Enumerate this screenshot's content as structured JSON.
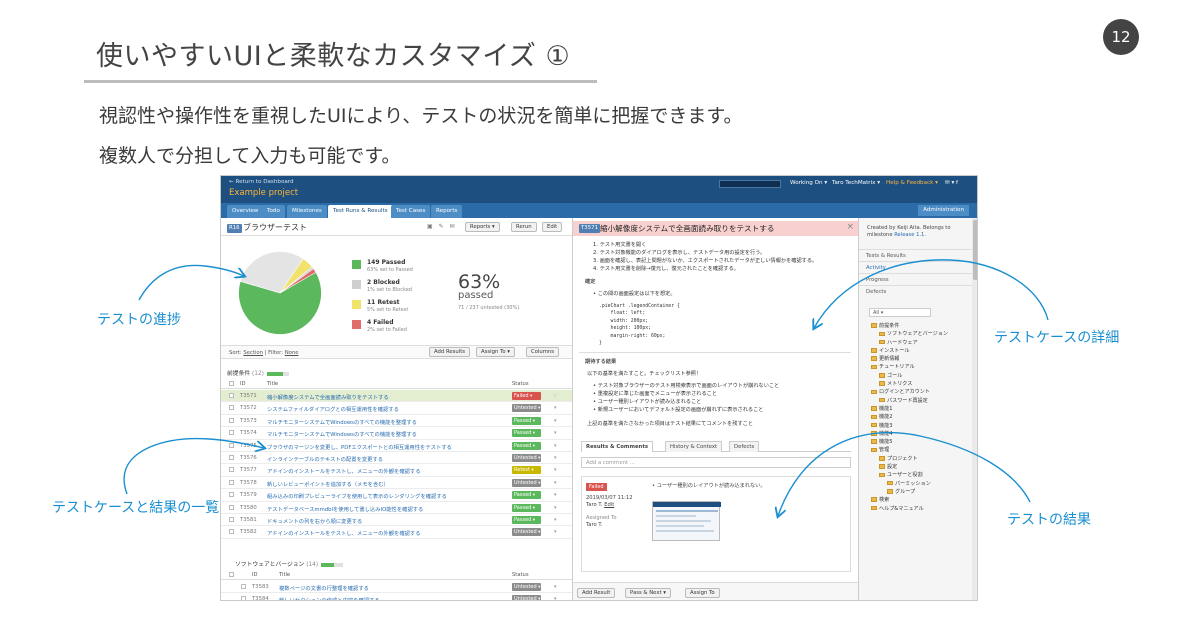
{
  "slide": {
    "title": "使いやすいUIと柔軟なカスタマイズ ①",
    "page_number": "12",
    "subtitle1": "視認性や操作性を重視したUIにより、テストの状況を簡単に把握できます。",
    "subtitle2": "複数人で分担して入力も可能です。",
    "callouts": {
      "progress": "テストの進捗",
      "case_list": "テストケースと結果の一覧",
      "case_detail": "テストケースの詳細",
      "result": "テストの結果"
    },
    "accent_color": "#1a8fd0"
  },
  "app": {
    "back_link": "← Return to Dashboard",
    "project": "Example project",
    "top_nav": {
      "working_on": "Working On ▾",
      "user": "Taro TechMatrix ▾",
      "help": "Help & Feedback ▾",
      "icons": "✉ ▾ f"
    },
    "tabs": [
      "Overview",
      "Todo",
      "Milestones",
      "Test Runs & Results",
      "Test Cases",
      "Reports"
    ],
    "active_tab": "Test Runs & Results",
    "admin_tab": "Administration",
    "run": {
      "badge": "R16",
      "title": "ブラウザーテスト",
      "buttons": {
        "reports": "Reports ▾",
        "rerun": "Rerun",
        "edit": "Edit"
      },
      "stats": [
        {
          "label": "149 Passed",
          "sub": "63% set to Passed",
          "color": "#5cb85c",
          "value": 149
        },
        {
          "label": "2 Blocked",
          "sub": "1% set to Blocked",
          "color": "#cfcfcf",
          "value": 2
        },
        {
          "label": "11 Retest",
          "sub": "5% set to Retest",
          "color": "#f0e26b",
          "value": 11
        },
        {
          "label": "4 Failed",
          "sub": "2% set to Failed",
          "color": "#e06c6c",
          "value": 4
        }
      ],
      "untested_value": 71,
      "untested_color": "#e4e4e4",
      "percent": "63%",
      "percent_label": "passed",
      "untested_note": "71 / 237 untested (30%)."
    },
    "toolbar": {
      "sort": "Sort:",
      "sort_value": "Section",
      "filter": "| Filter:",
      "filter_value": "None",
      "add_results": "Add Results",
      "assign_to": "Assign To ▾",
      "columns": "Columns"
    },
    "section1": {
      "title": "前提条件",
      "count": "(12)",
      "progress": 0.75
    },
    "columns": {
      "id": "ID",
      "title": "Title",
      "status": "Status"
    },
    "rows": [
      {
        "id": "T3571",
        "title": "縮小解像度システムで全画面読み取りをテストする",
        "status": "Failed",
        "color": "#d9534f",
        "selected": true
      },
      {
        "id": "T3572",
        "title": "システムファイルダイアログとの相互運用性を確認する",
        "status": "Untested",
        "color": "#8c8c8c"
      },
      {
        "id": "T3573",
        "title": "マルチモニターシステムでWindowsのすべての機能を整理する",
        "status": "Passed",
        "color": "#5cb85c"
      },
      {
        "id": "T3574",
        "title": "マルチモニターシステムでWindowsのすべての機能を整理する",
        "status": "Passed",
        "color": "#5cb85c"
      },
      {
        "id": "T3575",
        "title": "ブラウザのマージンを変更し、PDFエクスポートとの相互運用性をテストする",
        "status": "Passed",
        "color": "#5cb85c"
      },
      {
        "id": "T3576",
        "title": "インラインテーブルのテキストの配置を変更する",
        "status": "Untested",
        "color": "#8c8c8c"
      },
      {
        "id": "T3577",
        "title": "アドインのインストールをテストし、メニューの外観を確認する",
        "status": "Retest",
        "color": "#c9b800"
      },
      {
        "id": "T3578",
        "title": "新しいレビューポイントを追加する（メモを含む）",
        "status": "Untested",
        "color": "#8c8c8c"
      },
      {
        "id": "T3579",
        "title": "組み込みの印刷プレビューライブを使用して表示のレンダリングを確認する",
        "status": "Passed",
        "color": "#5cb85c"
      },
      {
        "id": "T3580",
        "title": "テストデータベースmmdbIを使用して書し込みIO能性を確認する",
        "status": "Passed",
        "color": "#5cb85c"
      },
      {
        "id": "T3581",
        "title": "ドキュメントの列を右から順に変更する",
        "status": "Passed",
        "color": "#5cb85c"
      },
      {
        "id": "T3582",
        "title": "アドインのインストールをテストし、メニューの外観を確認する",
        "status": "Untested",
        "color": "#8c8c8c"
      }
    ],
    "section2": {
      "title": "ソフトウェアとバージョン",
      "count": "(14)",
      "progress": 0.6
    },
    "rows2": [
      {
        "id": "T3583",
        "title": "複数ページの文書の行整理を確認する",
        "status": "Untested",
        "color": "#8c8c8c"
      },
      {
        "id": "T3584",
        "title": "新しいセクションの作成と内容を確認する",
        "status": "Untested",
        "color": "#8c8c8c"
      }
    ],
    "detail": {
      "badge": "T3571",
      "title": "縮小解像度システムで全画面読み取りをテストする",
      "steps": [
        "1. テスト用文書を開く",
        "2. テスト対象機能のダイアログを表示し、テストデータ用の設定を行う。",
        "3. 画面を確認し、表記上問題がないか、エクスポートされたデータが正しい情報かを確認する。",
        "4. テスト用文書を削除→復元し、復元されたことを確認する。"
      ],
      "confirm_label": "確定",
      "bullet1": "この間の画面設定は以下を想定。",
      "code": ".pieChart .legendContainer {\n    float: left;\n    width: 200px;\n    height: 100px;\n    margin-right: 60px;\n}",
      "expected_label": "期待する結果",
      "expected_intro": "以下の基準を満たすこと。チェックリスト参照！",
      "expected_bullets": [
        "• テスト対象ブラウザーのテスト用検索表示で画面のレイアウトが崩れないこと",
        "• 重複設定に準じた画面でメニューが表示されること",
        "• ユーザー種別レイアウトが読み込まれること",
        "• 新規ユーザーにおいてデフォルト設定の画面が崩れずに表示されること"
      ],
      "expected_footer": "上記の基準を満たさなかった項目はテスト結果にてコメントを残すこと",
      "result_tabs": [
        "Results & Comments",
        "History & Context",
        "Defects"
      ],
      "comment_placeholder": "Add a comment ...",
      "result": {
        "status": "Failed",
        "timestamp": "2019/03/07 11:12",
        "author": "Taro T.",
        "edit": "Edit",
        "assigned_label": "Assigned To",
        "assigned": "Taro T.",
        "comment": "• ユーザー種別のレイアウトが読み込まれない。"
      },
      "bottom_buttons": {
        "add_result": "Add Result",
        "pass_next": "Pass & Next ▾",
        "assign_to": "Assign To"
      }
    },
    "sidebar": {
      "created_by": "Created by Keiji Aita. Belongs to milestone",
      "milestone": "Release 1.1.",
      "nav": [
        "Tests & Results",
        "Activity",
        "Progress",
        "Defects"
      ],
      "filter": "All ▾",
      "tree": [
        {
          "label": "前提条件",
          "level": 0
        },
        {
          "label": "ソフトウェアとバージョン",
          "level": 1
        },
        {
          "label": "ハードウェア",
          "level": 1
        },
        {
          "label": "インストール",
          "level": 0
        },
        {
          "label": "更新情報",
          "level": 0
        },
        {
          "label": "チュートリアル",
          "level": 0
        },
        {
          "label": "ゴール",
          "level": 1
        },
        {
          "label": "メトリクス",
          "level": 1
        },
        {
          "label": "ログインとアカウント",
          "level": 0
        },
        {
          "label": "パスワード再設定",
          "level": 1
        },
        {
          "label": "機能1",
          "level": 0
        },
        {
          "label": "機能2",
          "level": 0
        },
        {
          "label": "機能3",
          "level": 0
        },
        {
          "label": "機能4",
          "level": 0
        },
        {
          "label": "機能5",
          "level": 0
        },
        {
          "label": "管理",
          "level": 0
        },
        {
          "label": "プロジェクト",
          "level": 1
        },
        {
          "label": "設定",
          "level": 1
        },
        {
          "label": "ユーザーと役割",
          "level": 1
        },
        {
          "label": "パーミッション",
          "level": 2
        },
        {
          "label": "グループ",
          "level": 2
        },
        {
          "label": "検索",
          "level": 0
        },
        {
          "label": "ヘルプ&マニュアル",
          "level": 0
        }
      ]
    }
  }
}
